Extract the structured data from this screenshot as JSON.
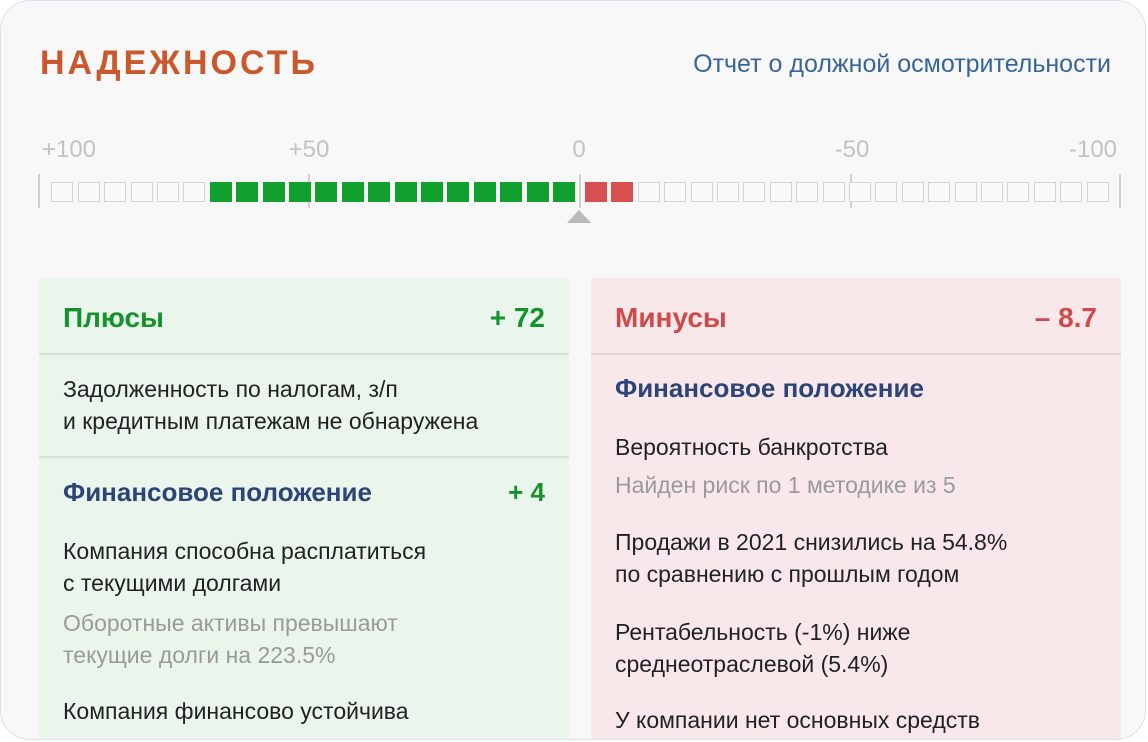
{
  "header": {
    "title": "НАДЕЖНОСТЬ",
    "report_link": "Отчет о должной осмотрительности"
  },
  "meter": {
    "scale_labels": [
      "+100",
      "+50",
      "0",
      "-50",
      "-100"
    ],
    "range": [
      100,
      -100
    ],
    "positive_value": 72,
    "negative_value": -8.7,
    "colors": {
      "positive": "#11a02d",
      "negative": "#d84f4f",
      "empty": "#d3d3d3"
    }
  },
  "plus": {
    "title": "Плюсы",
    "score": "+ 72",
    "item1_line1": "Задолженность по налогам, з/п",
    "item1_line2": "и кредитным платежам не обнаружена",
    "section_title": "Финансовое положение",
    "section_score": "+ 4",
    "item2_line1": "Компания способна расплатиться",
    "item2_line2": "с текущими долгами",
    "item2_note_line1": "Оборотные активы превышают",
    "item2_note_line2": "текущие долги на 223.5%",
    "item3": "Компания финансово устойчива"
  },
  "minus": {
    "title": "Минусы",
    "score": "– 8.7",
    "section_title": "Финансовое положение",
    "item1": "Вероятность банкротства",
    "item1_note": "Найден риск по 1 методике из 5",
    "item2_line1": "Продажи в 2021 снизились на 54.8%",
    "item2_line2": "по сравнению с прошлым годом",
    "item3_line1": "Рентабельность (-1%) ниже",
    "item3_line2": "среднеотраслевой (5.4%)",
    "item4": "У компании нет основных средств"
  }
}
